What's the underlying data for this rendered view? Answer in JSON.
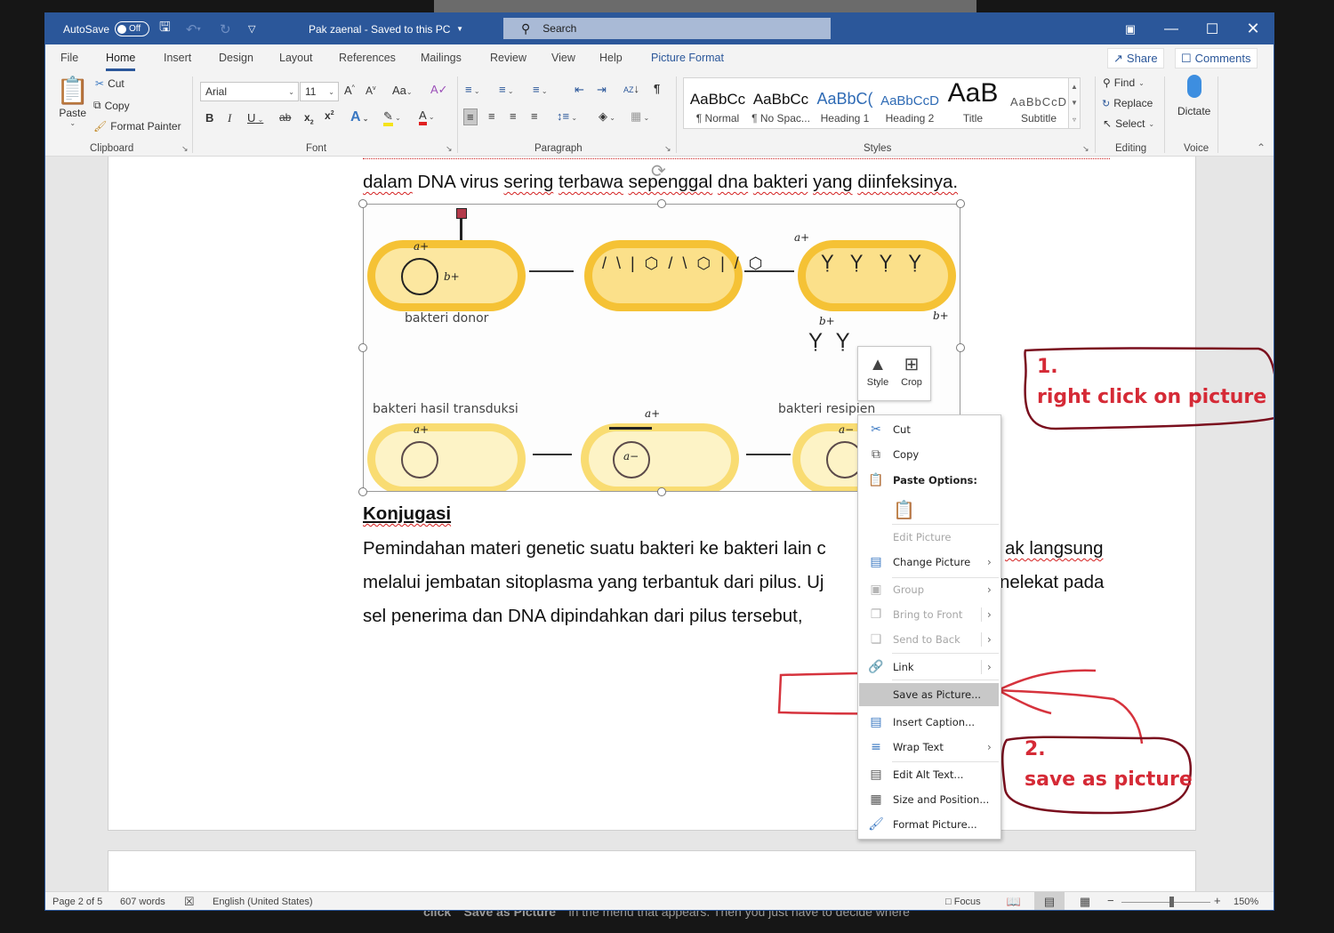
{
  "background": {
    "caption_bold_1": "click",
    "caption_bold_2": "\"Save as Picture\"",
    "caption_rest": "in the menu that appears. Then you just have to decide where"
  },
  "titlebar": {
    "autosave_label": "AutoSave",
    "autosave_state": "Off",
    "doc_title": "Pak zaenal  -  Saved to this PC",
    "search_placeholder": "Search",
    "colors": {
      "bar": "#2b579a"
    }
  },
  "tabs": [
    {
      "label": "File"
    },
    {
      "label": "Home",
      "active": true
    },
    {
      "label": "Insert"
    },
    {
      "label": "Design"
    },
    {
      "label": "Layout"
    },
    {
      "label": "References"
    },
    {
      "label": "Mailings"
    },
    {
      "label": "Review"
    },
    {
      "label": "View"
    },
    {
      "label": "Help"
    },
    {
      "label": "Picture Format",
      "contextual": true
    }
  ],
  "share_label": "Share",
  "comments_label": "Comments",
  "ribbon": {
    "clipboard": {
      "label": "Clipboard",
      "paste": "Paste",
      "cut": "Cut",
      "copy": "Copy",
      "format_painter": "Format Painter"
    },
    "font": {
      "label": "Font",
      "font_name": "Arial",
      "font_size": "11"
    },
    "paragraph": {
      "label": "Paragraph"
    },
    "styles": {
      "label": "Styles",
      "items": [
        {
          "preview": "AaBbCc",
          "name": "¶ Normal"
        },
        {
          "preview": "AaBbCc",
          "name": "¶ No Spac..."
        },
        {
          "preview": "AaBbC(",
          "name": "Heading 1"
        },
        {
          "preview": "AaBbCcD",
          "name": "Heading 2"
        },
        {
          "preview": "AaB",
          "name": "Title"
        },
        {
          "preview": "AaBbCcD",
          "name": "Subtitle"
        }
      ]
    },
    "editing": {
      "label": "Editing",
      "find": "Find",
      "replace": "Replace",
      "select": "Select"
    },
    "voice": {
      "label": "Voice",
      "dictate": "Dictate"
    }
  },
  "document": {
    "line1": [
      "dalam",
      "DNA",
      "virus",
      "sering",
      "terbawa",
      "sepenggal",
      "dna",
      "bakteri",
      "yang",
      "diinfeksinya."
    ],
    "picture": {
      "labels": {
        "donor": "bakteri donor",
        "result": "bakteri hasil transduksi",
        "recipient": "bakteri resipien"
      },
      "genes": {
        "a_plus": "a+",
        "b_plus": "b+",
        "a_minus": "a−"
      }
    },
    "heading": "Konjugasi",
    "para_line1": "Pemindahan materi genetic suatu bakteri ke bakteri lain c",
    "para_line1_end": "ak langsung",
    "para_line2": "melalui jembatan sitoplasma yang terbantuk dari pilus. Uj",
    "para_line2_end": "nelekat pada",
    "para_line3": "sel penerima dan DNA dipindahkan dari pilus tersebut,"
  },
  "mini_toolbar": {
    "style": "Style",
    "crop": "Crop"
  },
  "context_menu": {
    "items": [
      {
        "label": "Cut",
        "icon": "scissors-icon"
      },
      {
        "label": "Copy",
        "icon": "copy-icon"
      },
      {
        "label": "Paste Options:",
        "icon": "paste-icon"
      },
      {
        "label": "Edit Picture",
        "disabled": true
      },
      {
        "label": "Change Picture",
        "icon": "change-picture-icon",
        "submenu": true
      },
      {
        "label": "Group",
        "icon": "group-icon",
        "disabled": true,
        "submenu": true
      },
      {
        "label": "Bring to Front",
        "icon": "bring-front-icon",
        "disabled": true,
        "submenu": true
      },
      {
        "label": "Send to Back",
        "icon": "send-back-icon",
        "disabled": true,
        "submenu": true
      },
      {
        "label": "Link",
        "icon": "link-icon",
        "submenu": true
      },
      {
        "label": "Save as Picture...",
        "highlighted": true
      },
      {
        "label": "Insert Caption...",
        "icon": "caption-icon"
      },
      {
        "label": "Wrap Text",
        "icon": "wrap-text-icon",
        "submenu": true
      },
      {
        "label": "Edit Alt Text...",
        "icon": "alt-text-icon"
      },
      {
        "label": "Size and Position...",
        "icon": "size-position-icon"
      },
      {
        "label": "Format Picture...",
        "icon": "format-picture-icon"
      }
    ]
  },
  "annotations": {
    "step1_num": "1.",
    "step1_text": "right click on picture",
    "step2_num": "2.",
    "step2_text": "save as picture",
    "colors": {
      "text": "#d52a36",
      "outline": "#7a0f1e",
      "highlight_box": "#d6333d"
    }
  },
  "statusbar": {
    "page": "Page 2 of 5",
    "words": "607 words",
    "language": "English (United States)",
    "focus": "Focus",
    "zoom": "150%",
    "zoom_percent": 150
  }
}
